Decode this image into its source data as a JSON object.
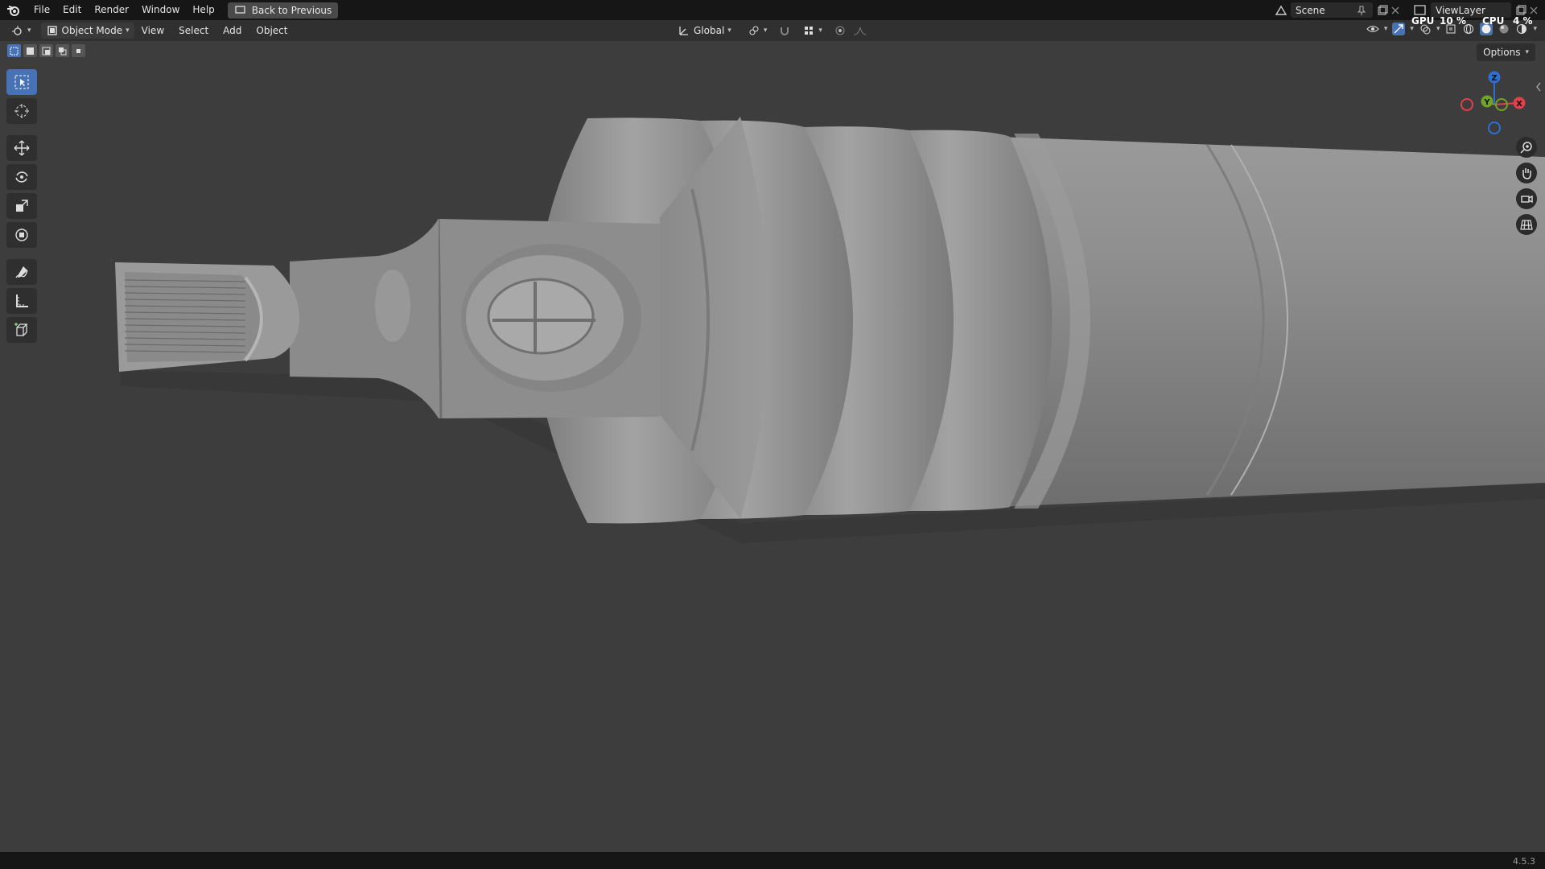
{
  "menubar": {
    "items": [
      "File",
      "Edit",
      "Render",
      "Window",
      "Help"
    ],
    "back_button": "Back to Previous",
    "scene": "Scene",
    "view_layer": "ViewLayer",
    "gpu_label": "GPU",
    "gpu_value": "10 %",
    "cpu_label": "CPU",
    "cpu_value": "4 %"
  },
  "viewport_header": {
    "mode": "Object Mode",
    "menus": [
      "View",
      "Select",
      "Add",
      "Object"
    ],
    "transform_orientation": "Global"
  },
  "options_label": "Options",
  "gizmo": {
    "z": "Z",
    "y": "Y",
    "x": "X"
  },
  "version": "4.5.3",
  "colors": {
    "accent": "#4772b3",
    "axis_x": "#e0414a",
    "axis_y": "#6fa32a",
    "axis_z": "#2f6fd1"
  }
}
